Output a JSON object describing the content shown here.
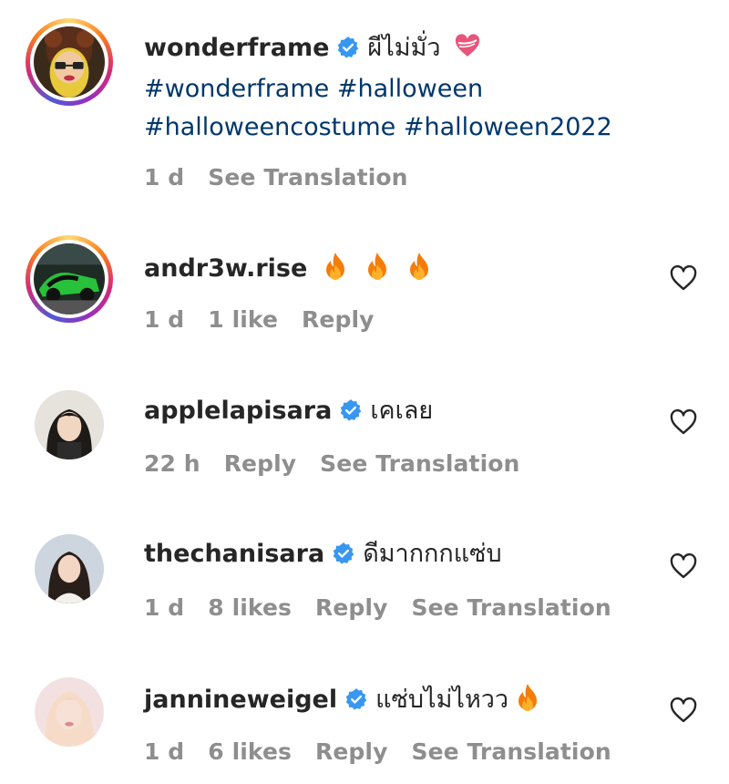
{
  "comments": [
    {
      "username": "wonderframe",
      "verified": true,
      "text": "ผีไม่มั่ว",
      "hashtags_line1": "#wonderframe #halloween",
      "hashtags_line2": "#halloweencostume #halloween2022",
      "time": "1 d",
      "see_translation": "See Translation",
      "emoji": "heart-emoji"
    },
    {
      "username": "andr3w.rise",
      "verified": false,
      "text": "",
      "emoji": "fire-emoji x3",
      "time": "1 d",
      "likes": "1 like",
      "reply": "Reply"
    },
    {
      "username": "applelapisara",
      "verified": true,
      "text": "เคเลย",
      "time": "22 h",
      "reply": "Reply",
      "see_translation": "See Translation"
    },
    {
      "username": "thechanisara",
      "verified": true,
      "text": "ดีมากกกแซ่บ",
      "time": "1 d",
      "likes": "8 likes",
      "reply": "Reply",
      "see_translation": "See Translation"
    },
    {
      "username": "jannineweigel",
      "verified": true,
      "text": "แซ่บไม่ไหวว",
      "emoji": "fire-emoji",
      "time": "1 d",
      "likes": "6 likes",
      "reply": "Reply",
      "see_translation": "See Translation"
    }
  ],
  "colors": {
    "text": "#262626",
    "meta": "#8e8e8e",
    "hashtag": "#00376b",
    "verified": "#3897f0",
    "fire": "#f47c0a"
  }
}
